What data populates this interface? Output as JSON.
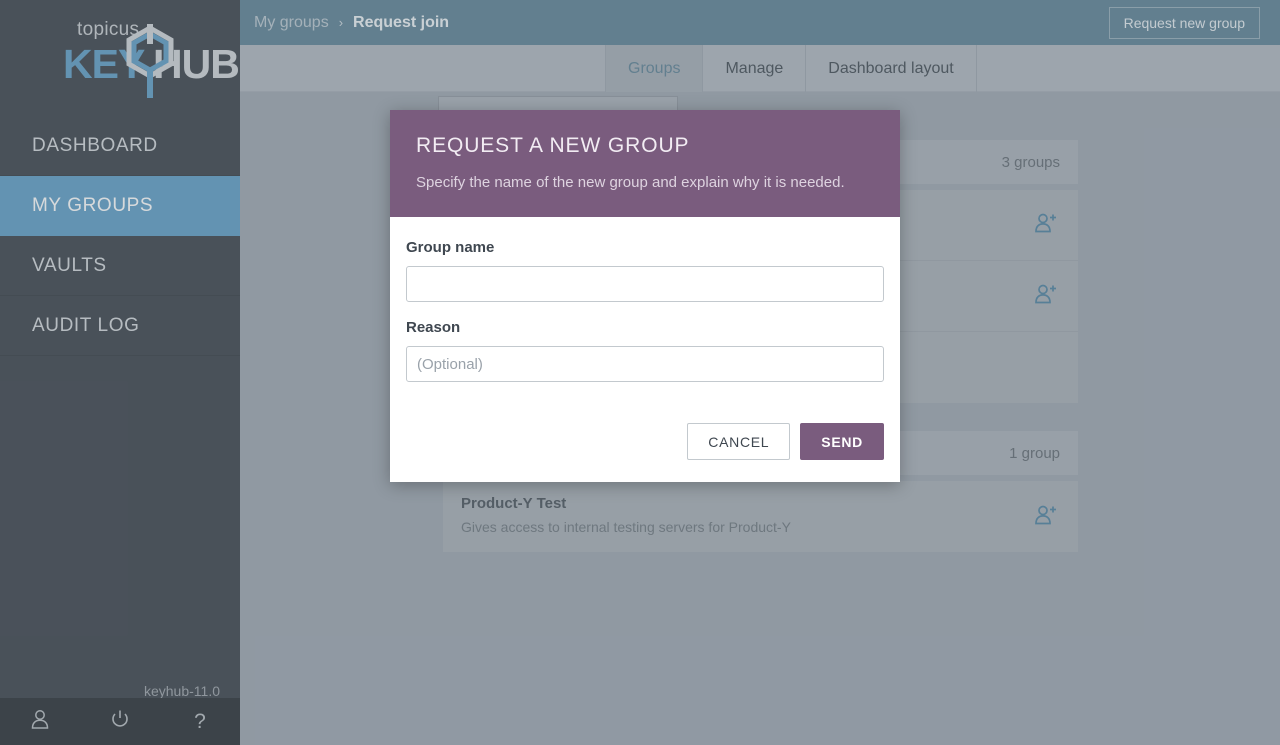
{
  "sidebar": {
    "logo": {
      "topicus": "topicus",
      "key": "KEY",
      "hub": "HUB"
    },
    "items": [
      {
        "label": "DASHBOARD",
        "active": false
      },
      {
        "label": "MY GROUPS",
        "active": true
      },
      {
        "label": "VAULTS",
        "active": false
      },
      {
        "label": "AUDIT LOG",
        "active": false
      }
    ],
    "version": "keyhub-11.0",
    "footer_icons": [
      {
        "name": "account-icon",
        "glyph": "person"
      },
      {
        "name": "power-icon",
        "glyph": "power"
      },
      {
        "name": "help-icon",
        "glyph": "?"
      }
    ]
  },
  "topbar": {
    "breadcrumb_parent": "My groups",
    "breadcrumb_separator": "›",
    "breadcrumb_current": "Request join",
    "request_new_group_label": "Request new group"
  },
  "tabs": [
    {
      "label": "Groups",
      "active": true
    },
    {
      "label": "Manage",
      "active": false
    },
    {
      "label": "Dashboard layout",
      "active": false
    }
  ],
  "content": {
    "search_placeholder": "",
    "sections": [
      {
        "count_label": "3 groups",
        "cards": [
          {
            "title": "",
            "desc": "",
            "icon": "person-add-icon",
            "has_icon": true
          },
          {
            "title": "",
            "desc": "",
            "icon": "person-add-icon",
            "has_icon": true
          },
          {
            "title": "",
            "desc": "",
            "icon": "",
            "has_icon": false
          }
        ]
      },
      {
        "count_label": "1 group",
        "cards": [
          {
            "title": "Product-Y Test",
            "desc": "Gives access to internal testing servers for Product-Y",
            "icon": "person-add-icon",
            "has_icon": true
          }
        ]
      }
    ]
  },
  "dialog": {
    "title": "REQUEST A NEW GROUP",
    "subtitle": "Specify the name of the new group and explain why it is needed.",
    "group_name_label": "Group name",
    "group_name_value": "",
    "group_name_placeholder": "",
    "reason_label": "Reason",
    "reason_value": "",
    "reason_placeholder": "(Optional)",
    "cancel_label": "CANCEL",
    "send_label": "SEND"
  },
  "colors": {
    "sidebar_bg": "#363d45",
    "sidebar_active": "#5b9bc4",
    "topbar_bg": "#5a7f93",
    "dialog_accent": "#7a5c7e",
    "content_bg": "#9ba4ae",
    "icon_blue": "#4a7f9e"
  }
}
